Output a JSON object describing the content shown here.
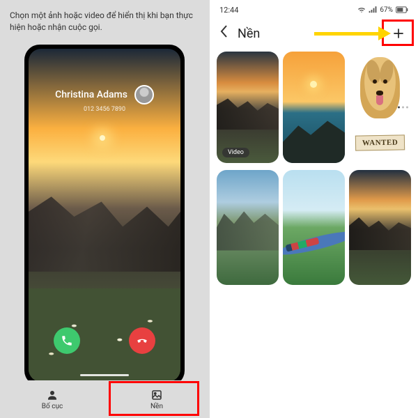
{
  "left": {
    "instruction": "Chọn một ảnh hoặc video để hiển thị khi bạn thực hiện hoặc nhận cuộc gọi.",
    "caller_name": "Christina Adams",
    "caller_number": "012 3456 7890",
    "tabs": {
      "layout": "Bố cục",
      "background": "Nền"
    }
  },
  "right": {
    "status": {
      "time": "12:44",
      "battery": "67%"
    },
    "title": "Nền",
    "video_badge": "Video",
    "dog_sign": "WANTED"
  }
}
